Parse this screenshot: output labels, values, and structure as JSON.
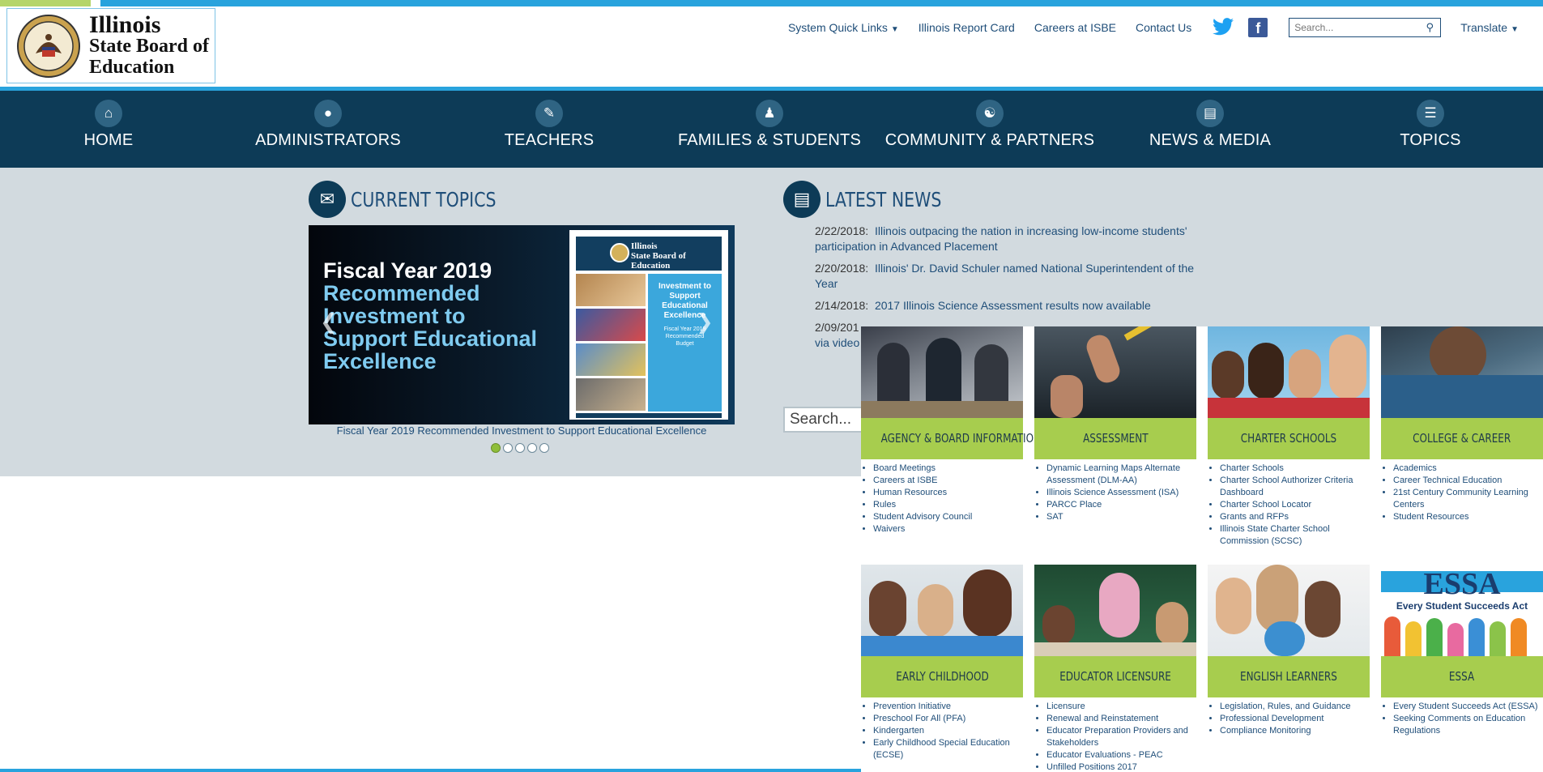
{
  "colors": {
    "accent_blue": "#29a3dd",
    "accent_green": "#b5d56a",
    "nav_bg": "#0d3b57",
    "tile_bar": "#a7cd4e",
    "link": "#1f4e79"
  },
  "logo": {
    "line1": "Illinois",
    "line2": "State Board of",
    "line3": "Education",
    "seal_icon": "illinois-state-seal"
  },
  "utility": {
    "quick_links": "System Quick Links",
    "report_card": "Illinois Report Card",
    "careers": "Careers at ISBE",
    "contact": "Contact Us",
    "twitter_icon": "twitter-icon",
    "facebook_icon": "facebook-icon",
    "search_placeholder": "Search...",
    "translate": "Translate"
  },
  "nav": [
    {
      "label": "HOME",
      "icon": "home-icon"
    },
    {
      "label": "ADMINISTRATORS",
      "icon": "user-icon"
    },
    {
      "label": "TEACHERS",
      "icon": "teacher-icon"
    },
    {
      "label": "FAMILIES & STUDENTS",
      "icon": "family-icon"
    },
    {
      "label": "COMMUNITY & PARTNERS",
      "icon": "group-icon"
    },
    {
      "label": "NEWS & MEDIA",
      "icon": "newspaper-icon"
    },
    {
      "label": "TOPICS",
      "icon": "list-icon"
    }
  ],
  "current_topics": {
    "title": "CURRENT TOPICS",
    "slide": {
      "line1": "Fiscal Year 2019",
      "line2": "Recommended",
      "line3": "Investment to",
      "line4": "Support Educational",
      "line5": "Excellence",
      "cover_title_1": "Illinois",
      "cover_title_2": "State Board of",
      "cover_title_3": "Education",
      "cover_box_1": "Investment to",
      "cover_box_2": "Support",
      "cover_box_3": "Educational",
      "cover_box_4": "Excellence",
      "cover_box_5": "Fiscal Year 2019",
      "cover_box_6": "Recommended",
      "cover_box_7": "Budget"
    },
    "caption": "Fiscal Year 2019 Recommended Investment to Support Educational Excellence",
    "dots_total": 5,
    "active_dot": 1
  },
  "latest_news": {
    "title": "LATEST NEWS",
    "items": [
      {
        "date": "2/22/2018:",
        "text": "Illinois outpacing the nation in increasing low-income students' participation in Advanced Placement"
      },
      {
        "date": "2/20/2018:",
        "text": "Illinois' Dr. David Schuler named National Superintendent of the Year"
      },
      {
        "date": "2/14/2018:",
        "text": "2017 Illinois Science Assessment results now available"
      },
      {
        "date": "2/09/201",
        "text": ""
      }
    ],
    "overflow_text": "via video",
    "search_placeholder": "Search..."
  },
  "tiles": [
    {
      "title": "AGENCY & BOARD INFORMATION",
      "links": [
        "Board Meetings",
        "Careers at ISBE",
        "Human Resources",
        "Rules",
        "Student Advisory Council",
        "Waivers"
      ]
    },
    {
      "title": "ASSESSMENT",
      "links": [
        "Dynamic Learning Maps Alternate Assessment (DLM-AA)",
        "Illinois Science Assessment (ISA)",
        "PARCC Place",
        "SAT"
      ]
    },
    {
      "title": "CHARTER SCHOOLS",
      "links": [
        "Charter Schools",
        "Charter School Authorizer Criteria Dashboard",
        "Charter School Locator",
        "Grants and RFPs",
        "Illinois State Charter School Commission (SCSC)"
      ]
    },
    {
      "title": "COLLEGE & CAREER",
      "links": [
        "Academics",
        "Career Technical Education",
        "21st Century Community Learning Centers",
        "Student Resources"
      ]
    },
    {
      "title": "EARLY CHILDHOOD",
      "links": [
        "Prevention Initiative",
        "Preschool For All (PFA)",
        "Kindergarten",
        "Early Childhood Special Education (ECSE)"
      ]
    },
    {
      "title": "EDUCATOR LICENSURE",
      "links": [
        "Licensure",
        "Renewal and Reinstatement",
        "Educator Preparation Providers and Stakeholders",
        "Educator Evaluations - PEAC",
        "Unfilled Positions 2017"
      ]
    },
    {
      "title": "ENGLISH LEARNERS",
      "links": [
        "Legislation, Rules, and Guidance",
        "Professional Development",
        "Compliance Monitoring"
      ]
    },
    {
      "title": "ESSA",
      "links": [
        "Every Student Succeeds Act (ESSA)",
        "Seeking Comments on Education Regulations"
      ],
      "banner_1": "ESSA",
      "banner_2": "Every Student Succeeds Act"
    }
  ]
}
